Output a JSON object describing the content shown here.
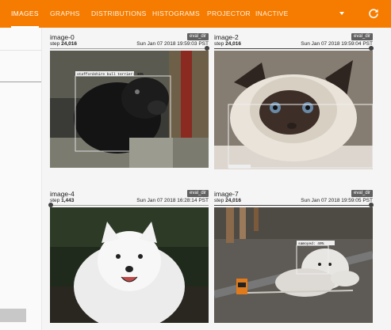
{
  "toolbar": {
    "tabs": [
      {
        "label": "IMAGES",
        "active": true
      },
      {
        "label": "GRAPHS",
        "active": false
      },
      {
        "label": "DISTRIBUTIONS",
        "active": false
      },
      {
        "label": "HISTOGRAMS",
        "active": false
      },
      {
        "label": "PROJECTOR",
        "active": false
      },
      {
        "label": "INACTIVE",
        "active": false
      }
    ],
    "reload_icon": "reload-icon",
    "dropdown_icon": "chevron-down-icon",
    "colors": {
      "background": "#f57c00",
      "text": "#ffffff"
    }
  },
  "cards": [
    {
      "title": "image-0",
      "step_label": "step",
      "step_value": "24,016",
      "timestamp": "Sun Jan 07 2018 19:59:03 PST",
      "run": "eval_dir",
      "slider_fraction": 1.0,
      "detection_labels": [
        "staffordshire bull terrier: 40%"
      ]
    },
    {
      "title": "image-2",
      "step_label": "step",
      "step_value": "24,016",
      "timestamp": "Sun Jan 07 2018 19:59:04 PST",
      "run": "eval_dir",
      "slider_fraction": 1.0,
      "detection_labels": []
    },
    {
      "title": "image-4",
      "step_label": "step",
      "step_value": "1,443",
      "timestamp": "Sun Jan 07 2018 16:28:14 PST",
      "run": "eval_dir",
      "slider_fraction": 0.0,
      "detection_labels": []
    },
    {
      "title": "image-7",
      "step_label": "step",
      "step_value": "24,016",
      "timestamp": "Sun Jan 07 2018 19:59:05 PST",
      "run": "eval_dir",
      "slider_fraction": 1.0,
      "detection_labels": [
        "samoyed: 40%"
      ]
    }
  ]
}
